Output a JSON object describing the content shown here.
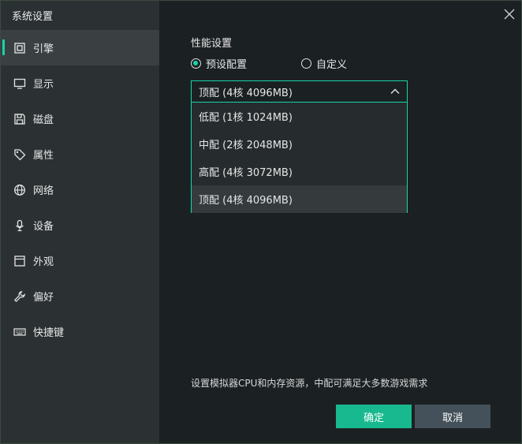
{
  "window": {
    "title": "系统设置"
  },
  "sidebar": {
    "items": [
      {
        "label": "引擎",
        "icon": "engine-icon",
        "active": true
      },
      {
        "label": "显示",
        "icon": "monitor-icon"
      },
      {
        "label": "磁盘",
        "icon": "disk-icon"
      },
      {
        "label": "属性",
        "icon": "tag-icon"
      },
      {
        "label": "网络",
        "icon": "globe-icon"
      },
      {
        "label": "设备",
        "icon": "microphone-icon"
      },
      {
        "label": "外观",
        "icon": "window-icon"
      },
      {
        "label": "偏好",
        "icon": "wrench-icon"
      },
      {
        "label": "快捷键",
        "icon": "keyboard-icon"
      }
    ]
  },
  "main": {
    "section_title": "性能设置",
    "radio_preset": "预设配置",
    "radio_custom": "自定义",
    "select_value": "顶配 (4核 4096MB)",
    "options": [
      "低配 (1核 1024MB)",
      "中配 (2核 2048MB)",
      "高配 (4核 3072MB)",
      "顶配 (4核 4096MB)"
    ],
    "hint": "设置模拟器CPU和内存资源，中配可满足大多数游戏需求"
  },
  "footer": {
    "ok_label": "确定",
    "cancel_label": "取消"
  },
  "colors": {
    "accent": "#19d4a8",
    "ok_button": "#19b98f",
    "cancel_button": "#44515a"
  }
}
